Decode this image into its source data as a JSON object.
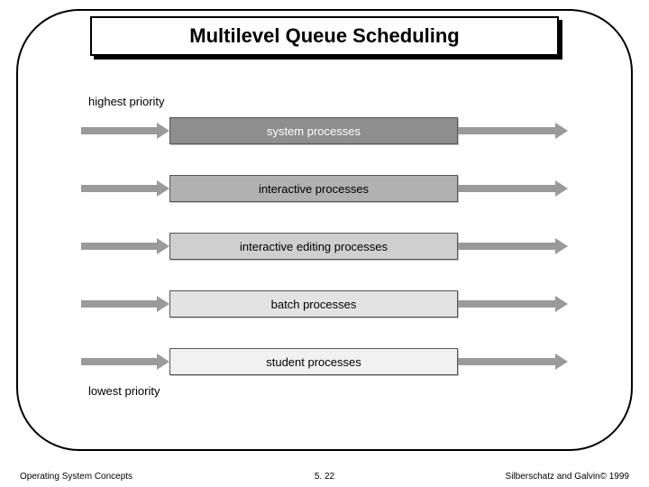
{
  "title": "Multilevel Queue Scheduling",
  "top_label": "highest priority",
  "bottom_label": "lowest priority",
  "queues": [
    {
      "label": "system processes",
      "fill": "#8e8e8e",
      "text": "#ffffff"
    },
    {
      "label": "interactive processes",
      "fill": "#b1b1b1",
      "text": "#000000"
    },
    {
      "label": "interactive editing processes",
      "fill": "#cfcfcf",
      "text": "#000000"
    },
    {
      "label": "batch processes",
      "fill": "#e3e3e3",
      "text": "#000000"
    },
    {
      "label": "student processes",
      "fill": "#f1f1f1",
      "text": "#000000"
    }
  ],
  "footer": {
    "left": "Operating System Concepts",
    "center": "5. 22",
    "right": "Silberschatz and Galvin© 1999"
  }
}
